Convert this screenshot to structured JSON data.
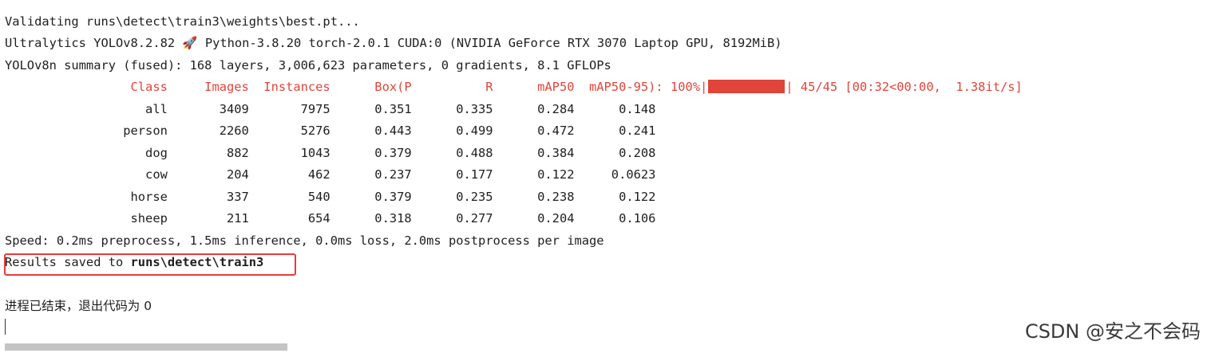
{
  "console": {
    "validating": "Validating runs\\detect\\train3\\weights\\best.pt...",
    "env_prefix": "Ultralytics YOLOv8.2.82 ",
    "rocket_icon": "rocket-icon",
    "env_rest": " Python-3.8.20 torch-2.0.1 CUDA:0 (NVIDIA GeForce RTX 3070 Laptop GPU, 8192MiB)",
    "summary": "YOLOv8n summary (fused): 168 layers, 3,006,623 parameters, 0 gradients, 8.1 GFLOPs",
    "header_cols": "                 Class     Images  Instances      Box(P          R      mAP50  mAP50-95): 100%|",
    "progress_fraction": 1.0,
    "progress_tail": "| 45/45 [00:32<00:00,  1.38it/s]",
    "rows": [
      "                   all       3409       7975      0.351      0.335      0.284      0.148",
      "                person       2260       5276      0.443      0.499      0.472      0.241",
      "                   dog        882       1043      0.379      0.488      0.384      0.208",
      "                   cow        204        462      0.237      0.177      0.122     0.0623",
      "                 horse        337        540      0.379      0.235      0.238      0.122",
      "                 sheep        211        654      0.318      0.277      0.204      0.106"
    ],
    "speed": "Speed: 0.2ms preprocess, 1.5ms inference, 0.0ms loss, 2.0ms postprocess per image",
    "results_prefix": "Results saved to ",
    "results_path": "runs\\detect\\train3",
    "exit_msg": "进程已结束，退出代码为 0"
  },
  "watermark": "CSDN @安之不会码",
  "colors": {
    "accent_red": "#e0443a",
    "text": "#1e1e1e",
    "background": "#ffffff"
  }
}
